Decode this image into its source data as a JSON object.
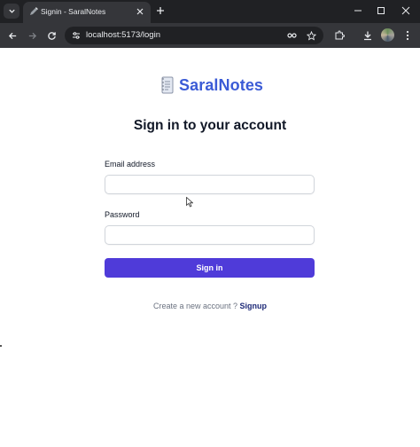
{
  "browser": {
    "tab": {
      "title": "Signin - SaralNotes"
    },
    "address_bar": {
      "url": "localhost:5173/login"
    }
  },
  "brand": {
    "name": "SaralNotes"
  },
  "form": {
    "heading": "Sign in to your account",
    "email_label": "Email address",
    "email_value": "",
    "password_label": "Password",
    "password_value": "",
    "submit_label": "Sign in"
  },
  "footer": {
    "prompt": "Create a new account ? ",
    "link_label": "Signup"
  },
  "colors": {
    "brand": "#3b5bd6",
    "primary_button": "#4f3bd9",
    "link": "#1e2a78",
    "chrome_dark": "#202124"
  }
}
